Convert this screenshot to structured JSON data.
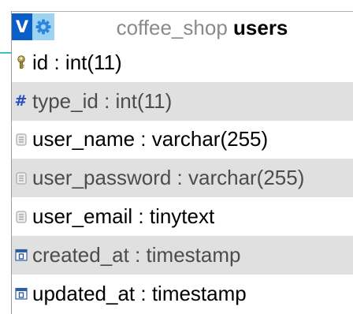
{
  "table": {
    "database": "coffee_shop",
    "name": "users",
    "buttons": {
      "toggle_label": "V",
      "options_icon": "gear-icon"
    },
    "columns": [
      {
        "name": "id",
        "type": "int(11)",
        "icon": "key-icon",
        "alt": false
      },
      {
        "name": "type_id",
        "type": "int(11)",
        "icon": "hash-icon",
        "alt": true
      },
      {
        "name": "user_name",
        "type": "varchar(255)",
        "icon": "text-field-icon",
        "alt": false
      },
      {
        "name": "user_password",
        "type": "varchar(255)",
        "icon": "text-field-icon",
        "alt": true
      },
      {
        "name": "user_email",
        "type": "tinytext",
        "icon": "text-field-icon",
        "alt": false
      },
      {
        "name": "created_at",
        "type": "timestamp",
        "icon": "calendar-icon",
        "alt": true
      },
      {
        "name": "updated_at",
        "type": "timestamp",
        "icon": "calendar-icon",
        "alt": false
      }
    ]
  },
  "colors": {
    "toggle_bg": "#0a5ec9",
    "options_bg": "#9dd3f2",
    "alt_row_bg": "#e0e0e0",
    "connector": "#3ec1c9",
    "hash_color": "#2b4cc3"
  }
}
